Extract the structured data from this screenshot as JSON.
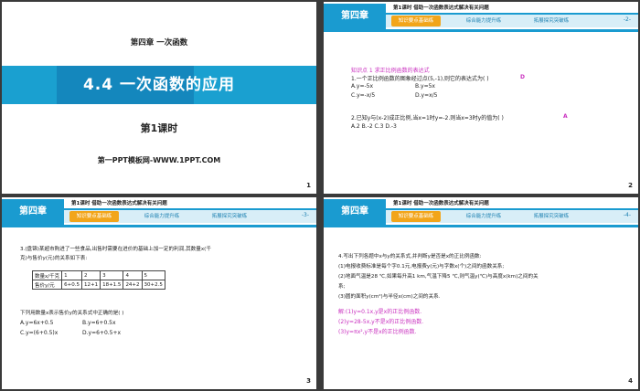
{
  "slide1": {
    "chapter": "第四章  一次函数",
    "title": "4.4    一次函数的应用",
    "lesson": "第1课时",
    "site": "第一PPT模板网-WWW.1PPT.COM",
    "number": "1"
  },
  "header": {
    "chapter_badge": "第四章",
    "subtitle": "第1课时  借助一次函数表达式解决有关问题",
    "tabs": [
      "知识要点基础练",
      "综合能力提升练",
      "拓展探究突破练"
    ]
  },
  "slide2": {
    "page_indicator": "-2-",
    "number": "2",
    "point": "知识点 1   求正比例函数的表达式",
    "q1": "1.一个正比例函数的图象经过点(5,-1),则它的表达式为(     )",
    "q1_answer": "D",
    "optA": "A.y=-5x",
    "optB": "B.y=5x",
    "optC": "C.y=-x/5",
    "optD": "D.y=x/5",
    "q2": "2.已知y与(x-2)成正比例,当x=1时y=-2.则当x=3时y的值为(     )",
    "q2_answer": "A",
    "q2_opts": "A.2          B.-2     C.3     D.-3"
  },
  "slide3": {
    "page_indicator": "-3-",
    "number": "3",
    "q3_line1": "3.(盘锦)某超市购进了一些食品,出售时需要在进价的基础上加一定的利润,其数量x(千",
    "q3_line2": "克)与售价y(元)的关系如下表:",
    "table": [
      [
        "数量x/千克",
        "1",
        "2",
        "3",
        "4",
        "5"
      ],
      [
        "售价y/元",
        "6+0.5",
        "12+1",
        "18+1.5",
        "24+2",
        "30+2.5"
      ]
    ],
    "q3_line3": "下列用数量x表示售价y的关系式中正确的是(      )",
    "optA": "A.y=6x+0.5",
    "optB": "B.y=6+0.5x",
    "optC": "C.y=(6+0.5)x",
    "optD": "D.y=6+0.5+x"
  },
  "slide4": {
    "page_indicator": "-4-",
    "number": "4",
    "q4": "4.写出下列各题中x与y的关系式,并判断y是否是x的正比例函数:",
    "items": [
      "(1)电报收费标准是每个字0.1元,电报费y(元)与字数x(个)之间的函数关系;",
      "(2)地面气温是28 ℃,如果每升高1 km,气温下降5 ℃,则气温y(℃)与高度x(km)之间的关",
      "系;",
      "(3)圆的面积y(cm²)与半径x(cm)之间的关系."
    ],
    "answers": [
      "解:(1)y=0.1x,y是x的正比例函数.",
      "(2)y=28-5x,y不是x的正比例函数.",
      "(3)y=πx²,y不是x的正比例函数."
    ]
  }
}
